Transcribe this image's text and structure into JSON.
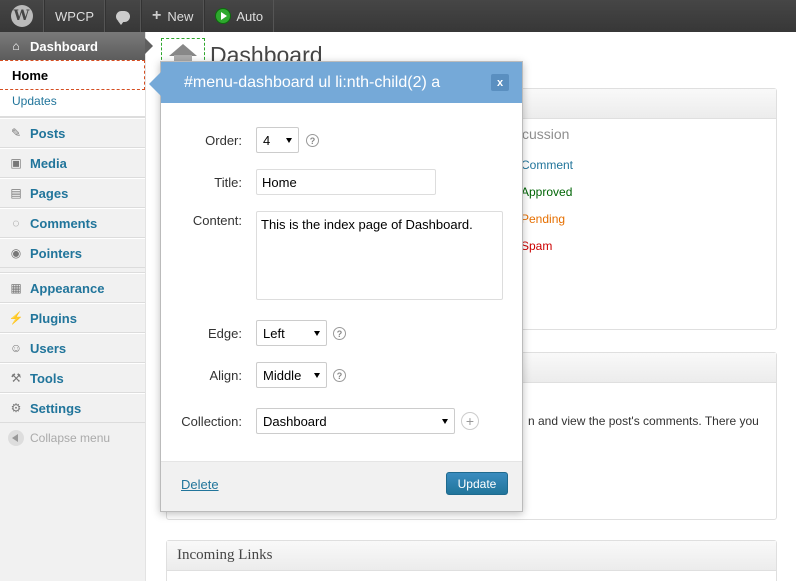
{
  "adminbar": {
    "wp_logo": "W",
    "site_name": "WPCP",
    "comments_icon": "comment-bubble-icon",
    "new_label": "New",
    "new_plus": "+",
    "auto_label": "Auto"
  },
  "sidebar": {
    "dashboard": "Dashboard",
    "home": "Home",
    "updates": "Updates",
    "items": [
      {
        "label": "Posts",
        "icon": "pushpin-icon",
        "glyph": "✎"
      },
      {
        "label": "Media",
        "icon": "media-icon",
        "glyph": "▣"
      },
      {
        "label": "Pages",
        "icon": "pages-icon",
        "glyph": "▤"
      },
      {
        "label": "Comments",
        "icon": "comments-icon",
        "glyph": "◌"
      },
      {
        "label": "Pointers",
        "icon": "pointers-icon",
        "glyph": "◉"
      },
      {
        "label": "Appearance",
        "icon": "appearance-icon",
        "glyph": "▦"
      },
      {
        "label": "Plugins",
        "icon": "plugins-icon",
        "glyph": "⚡"
      },
      {
        "label": "Users",
        "icon": "users-icon",
        "glyph": "☺"
      },
      {
        "label": "Tools",
        "icon": "tools-icon",
        "glyph": "⚒"
      },
      {
        "label": "Settings",
        "icon": "settings-icon",
        "glyph": "⚙"
      }
    ],
    "collapse": "Collapse menu"
  },
  "main": {
    "page_title": "Dashboard",
    "discussion_header": "cussion",
    "discussion_items": [
      {
        "label": "Comment",
        "color": "#21759b"
      },
      {
        "label": "Approved",
        "color": "#006505"
      },
      {
        "label": "Pending",
        "color": "#e66f00"
      },
      {
        "label": "Spam",
        "color": "#cc0000"
      }
    ],
    "recent_text": "n and view the post's comments. There you",
    "incoming_links": "Incoming Links"
  },
  "popup": {
    "title": "#menu-dashboard ul li:nth-child(2) a",
    "close": "x",
    "order_label": "Order:",
    "order_value": "4",
    "title_label": "Title:",
    "title_value": "Home",
    "content_label": "Content:",
    "content_value": "This is the index page of Dashboard.",
    "edge_label": "Edge:",
    "edge_value": "Left",
    "align_label": "Align:",
    "align_value": "Middle",
    "collection_label": "Collection:",
    "collection_value": "Dashboard",
    "help": "?",
    "plus": "+",
    "delete_label": "Delete",
    "update_label": "Update"
  },
  "colors": {
    "link": "#21759b",
    "popup_header": "#75a9d8",
    "admin_bar": "#464646"
  }
}
